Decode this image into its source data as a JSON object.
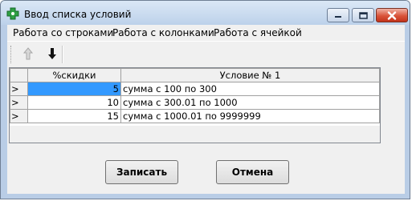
{
  "window": {
    "title": "Ввод списка условий"
  },
  "menu": [
    "Работа со строками",
    "Работа с колонками",
    "Работа с ячейкой"
  ],
  "grid": {
    "columns": [
      "%скидки",
      "Условие № 1"
    ],
    "rows": [
      {
        "indicator": ">",
        "discount": "5",
        "condition": "сумма с 100 по 300"
      },
      {
        "indicator": ">",
        "discount": "10",
        "condition": "сумма с 300.01 по 1000"
      },
      {
        "indicator": ">",
        "discount": "15",
        "condition": "сумма с 1000.01 по 9999999"
      }
    ]
  },
  "buttons": {
    "save_label": "Записать",
    "cancel_label": "Отмена"
  },
  "colors": {
    "selection": "#3399ff",
    "close_button": "#d9543a",
    "app_icon": "#2ea043"
  },
  "icons": {
    "app": "plus-gear-icon",
    "move_up": "arrow-up-icon",
    "move_down": "arrow-down-icon"
  }
}
